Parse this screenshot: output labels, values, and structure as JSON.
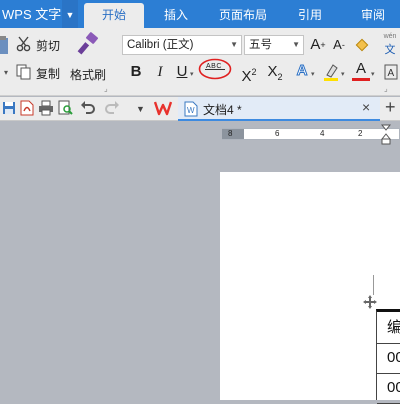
{
  "app": {
    "menu_label": "WPS 文字"
  },
  "tabs": [
    {
      "label": "开始",
      "active": true
    },
    {
      "label": "插入"
    },
    {
      "label": "页面布局"
    },
    {
      "label": "引用"
    },
    {
      "label": "审阅"
    }
  ],
  "clipboard": {
    "cut_label": "剪切",
    "copy_label": "复制",
    "format_painter_label": "格式刷"
  },
  "font": {
    "family": "Calibri (正文)",
    "size": "五号"
  },
  "format_buttons": {
    "bold": "B",
    "italic": "I",
    "underline": "U",
    "strike_abc": "ABC",
    "superscript_base": "X",
    "superscript_exp": "2",
    "subscript_base": "X",
    "subscript_exp": "2",
    "grow": "A",
    "shrink": "A",
    "highlight": "A",
    "font_color": "A",
    "pinyin": "文"
  },
  "document": {
    "tab_title": "文档4 *"
  },
  "ruler": {
    "ticks": [
      "8",
      "6",
      "4",
      "2"
    ]
  },
  "table": {
    "cells": [
      "编",
      "00",
      "00"
    ]
  },
  "colors": {
    "tabbar": "#2c7ed4",
    "ribbon": "#ececec",
    "workspace": "#b4b8c0",
    "highlight_circle": "#e02020",
    "font_color_red": "#e02020",
    "wps_red": "#e8322d"
  }
}
